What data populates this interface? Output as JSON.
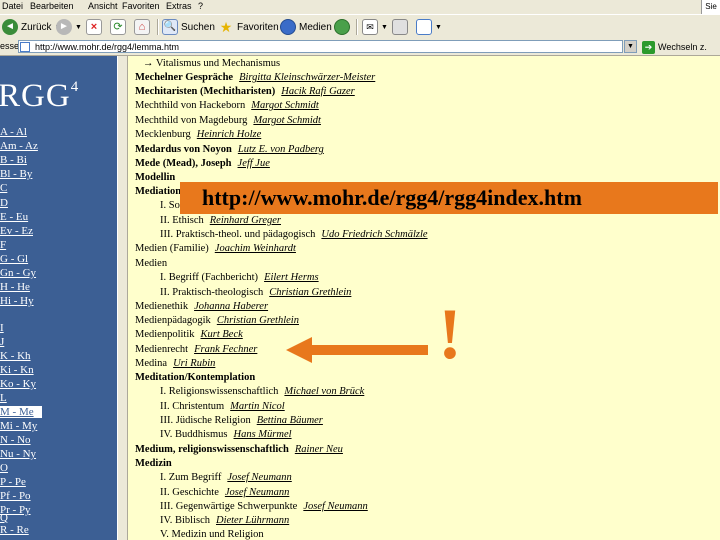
{
  "menu": [
    "Datei",
    "Bearbeiten",
    "Ansicht",
    "Favoriten",
    "Extras",
    "?"
  ],
  "menu_right": "Sie",
  "toolbar": {
    "back": "Zurück",
    "search": "Suchen",
    "favorites": "Favoriten",
    "media": "Medien"
  },
  "address": {
    "label": "esse",
    "url": "http://www.mohr.de/rgg4/lemma.htm",
    "go": "Wechseln z."
  },
  "sidebar": {
    "logo": "RGG",
    "logo_sup": "4",
    "items": [
      {
        "label": "A - Al"
      },
      {
        "label": "Am - Az"
      },
      {
        "label": "B - Bi"
      },
      {
        "label": "Bl - By"
      },
      {
        "label": "C"
      },
      {
        "label": "D"
      },
      {
        "label": "E - Eu"
      },
      {
        "label": "Ev - Ez"
      },
      {
        "label": "F"
      },
      {
        "label": "G - Gl"
      },
      {
        "label": "Gn - Gy"
      },
      {
        "label": "H - He"
      },
      {
        "label": "Hi - Hy"
      },
      {
        "label": "I"
      },
      {
        "label": "J"
      },
      {
        "label": "K - Kh"
      },
      {
        "label": "Ki - Kn"
      },
      {
        "label": "Ko - Ky"
      },
      {
        "label": "L"
      },
      {
        "label": "M - Me"
      },
      {
        "label": "Mi - My"
      },
      {
        "label": "N - No"
      },
      {
        "label": "Nu - Ny"
      },
      {
        "label": "O"
      },
      {
        "label": "P - Pe"
      },
      {
        "label": "Pf - Po"
      },
      {
        "label": "Pr - Py"
      },
      {
        "label": "Q"
      },
      {
        "label": "R - Re"
      }
    ]
  },
  "entries": [
    {
      "head": "→ Vitalismus und Mechanismus",
      "author": ""
    },
    {
      "head": "Mechelner Gespräche",
      "author": "Birgitta Kleinschwärzer-Meister"
    },
    {
      "head": "Mechitaristen (Mechitharisten)",
      "author": "Hacik Rafi Gazer"
    },
    {
      "head": "Mechthild von Hackeborn",
      "author": "Margot Schmidt"
    },
    {
      "head": "Mechthild von Magdeburg",
      "author": "Margot Schmidt"
    },
    {
      "head": "Mecklenburg",
      "author": "Heinrich Holze"
    },
    {
      "head": "Medardus von Noyon",
      "author": "Lutz E. von Padberg"
    },
    {
      "head": "Mede (Mead), Joseph",
      "author": "Jeff Jue"
    },
    {
      "head": "Modellin",
      "author": ""
    },
    {
      "head": "Mediation",
      "author": ""
    },
    {
      "head": "I. So",
      "author": ""
    },
    {
      "head": "II. Ethisch",
      "author": "Reinhard Greger"
    },
    {
      "head": "III. Praktisch-theol. und pädagogisch",
      "author": "Udo Friedrich Schmälzle"
    },
    {
      "head": "Medien (Familie)",
      "author": "Joachim Weinhardt"
    },
    {
      "head": "Medien",
      "author": ""
    },
    {
      "head": "I. Begriff (Fachbericht)",
      "author": "Eilert Herms"
    },
    {
      "head": "II. Praktisch-theologisch",
      "author": "Christian Grethlein"
    },
    {
      "head": "Medienethik",
      "author": "Johanna Haberer"
    },
    {
      "head": "Medienpädagogik",
      "author": "Christian Grethlein"
    },
    {
      "head": "Medienpolitik",
      "author": "Kurt Beck"
    },
    {
      "head": "Medienrecht",
      "author": "Frank Fechner"
    },
    {
      "head": "Medina",
      "author": "Uri Rubin"
    },
    {
      "head": "Meditation/Kontemplation",
      "author": ""
    },
    {
      "head": "I. Religionswissenschaftlich",
      "author": "Michael von Brück"
    },
    {
      "head": "II. Christentum",
      "author": "Martin Nicol"
    },
    {
      "head": "III. Jüdische Religion",
      "author": "Bettina Bäumer"
    },
    {
      "head": "IV. Buddhismus",
      "author": "Hans Mürmel"
    },
    {
      "head": "Medium, religionswissenschaftlich",
      "author": "Rainer Neu"
    },
    {
      "head": "Medizin",
      "author": ""
    },
    {
      "head": "I. Zum Begriff",
      "author": "Josef Neumann"
    },
    {
      "head": "II. Geschichte",
      "author": "Josef Neumann"
    },
    {
      "head": "III. Gegenwärtige Schwerpunkte",
      "author": "Josef Neumann"
    },
    {
      "head": "IV. Biblisch",
      "author": "Dieter Lührmann"
    },
    {
      "head": "V. Medizin und Religion",
      "author": ""
    }
  ],
  "overlay": {
    "url": "http://www.mohr.de/rgg4/rgg4index.htm",
    "exclaim": "!"
  },
  "colors": {
    "sidebar_bg": "#3c5f94",
    "content_bg": "#ffffcc",
    "banner": "#e8781c"
  }
}
